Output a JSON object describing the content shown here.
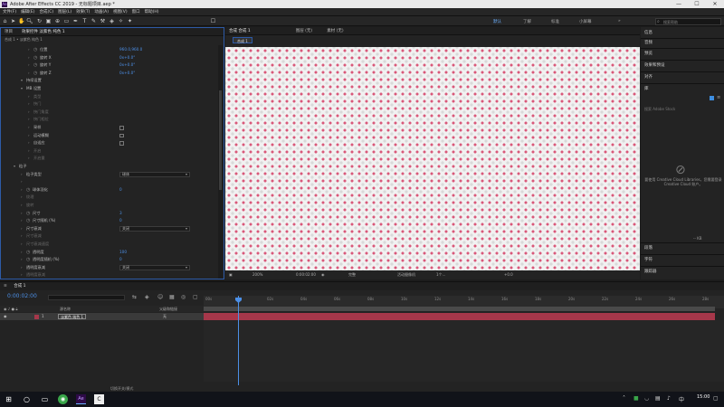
{
  "window": {
    "app_title": "Adobe After Effects CC 2019 - 无标题项目.aep *",
    "minimize": "—",
    "maximize": "☐",
    "close": "✕"
  },
  "menu": [
    "文件(F)",
    "编辑(E)",
    "合成(C)",
    "图层(L)",
    "效果(T)",
    "动画(A)",
    "视图(V)",
    "窗口",
    "帮助(H)"
  ],
  "toolbar": {
    "workspaces": [
      {
        "label": "默认",
        "active": true
      },
      {
        "label": "了解",
        "active": false
      },
      {
        "label": "标准",
        "active": false
      },
      {
        "label": "小屏幕",
        "active": false
      }
    ],
    "workspace_more": "»",
    "search_placeholder": "搜索帮助"
  },
  "left_panel": {
    "tabs": [
      "项目",
      "效果控件 淡紫色 纯色 1"
    ],
    "breadcrumb": "合成 1 • 淡紫色 纯色 1",
    "props": [
      {
        "label": "位置",
        "value": "960.0,960.0",
        "indent": 2,
        "stopwatch": true,
        "kind": "value"
      },
      {
        "label": "旋转 X",
        "value": "0x+0.0°",
        "indent": 2,
        "stopwatch": true,
        "kind": "value"
      },
      {
        "label": "旋转 Y",
        "value": "0x+0.0°",
        "indent": 2,
        "stopwatch": true,
        "kind": "value"
      },
      {
        "label": "旋转 Z",
        "value": "0x+0.0°",
        "indent": 2,
        "stopwatch": true,
        "kind": "value"
      },
      {
        "label": "持续设置",
        "value": "",
        "indent": 1,
        "stopwatch": false,
        "kind": "group"
      },
      {
        "label": "MB 设置",
        "value": "",
        "indent": 1,
        "stopwatch": false,
        "kind": "group"
      },
      {
        "label": "类型",
        "value": "",
        "indent": 2,
        "stopwatch": false,
        "kind": "dim"
      },
      {
        "label": "快门",
        "value": "",
        "indent": 2,
        "stopwatch": false,
        "kind": "dim"
      },
      {
        "label": "快门角度",
        "value": "",
        "indent": 2,
        "stopwatch": false,
        "kind": "dim"
      },
      {
        "label": "快门相位",
        "value": "",
        "indent": 2,
        "stopwatch": false,
        "kind": "dim"
      },
      {
        "label": "采样",
        "value": "",
        "indent": 2,
        "stopwatch": false,
        "kind": "check"
      },
      {
        "label": "运动模糊",
        "value": "",
        "indent": 2,
        "stopwatch": false,
        "kind": "check"
      },
      {
        "label": "自适应",
        "value": "",
        "indent": 2,
        "stopwatch": false,
        "kind": "check"
      },
      {
        "label": "开启",
        "value": "",
        "indent": 2,
        "stopwatch": false,
        "kind": "dim"
      },
      {
        "label": "开启量",
        "value": "",
        "indent": 2,
        "stopwatch": false,
        "kind": "dim"
      },
      {
        "label": "粒子",
        "value": "",
        "indent": 0,
        "stopwatch": false,
        "kind": "group"
      },
      {
        "label": "粒子类型",
        "value": "球体",
        "indent": 1,
        "stopwatch": false,
        "kind": "dropdown"
      },
      {
        "label": "",
        "value": "",
        "indent": 1,
        "stopwatch": false,
        "kind": "dim"
      },
      {
        "label": "球体羽化",
        "value": "0",
        "indent": 1,
        "stopwatch": true,
        "kind": "value"
      },
      {
        "label": "纹理",
        "value": "",
        "indent": 1,
        "stopwatch": false,
        "kind": "dim"
      },
      {
        "label": "旋转",
        "value": "",
        "indent": 1,
        "stopwatch": false,
        "kind": "dim"
      },
      {
        "label": "尺寸",
        "value": "3",
        "indent": 1,
        "stopwatch": true,
        "kind": "value"
      },
      {
        "label": "尺寸随机 (%)",
        "value": "0",
        "indent": 1,
        "stopwatch": true,
        "kind": "value"
      },
      {
        "label": "尺寸衰减",
        "value": "关闭",
        "indent": 1,
        "stopwatch": false,
        "kind": "dropdown"
      },
      {
        "label": "尺寸衰减",
        "value": "",
        "indent": 1,
        "stopwatch": false,
        "kind": "dim"
      },
      {
        "label": "尺寸衰减速度",
        "value": "",
        "indent": 1,
        "stopwatch": false,
        "kind": "dim"
      },
      {
        "label": "透明度",
        "value": "100",
        "indent": 1,
        "stopwatch": true,
        "kind": "value"
      },
      {
        "label": "透明度随机 (%)",
        "value": "0",
        "indent": 1,
        "stopwatch": true,
        "kind": "value"
      },
      {
        "label": "透明度衰减",
        "value": "关闭",
        "indent": 1,
        "stopwatch": false,
        "kind": "dropdown"
      },
      {
        "label": "透明度衰减",
        "value": "",
        "indent": 1,
        "stopwatch": false,
        "kind": "dim"
      }
    ]
  },
  "viewer": {
    "tabs": [
      "合成 合成 1",
      "图层 (无)",
      "素材 (无)"
    ],
    "subtab": "合成 1",
    "zoom": "200%",
    "timecode": "0:00:02:00",
    "quality": "完整",
    "camera": "活动摄像机",
    "views": "1个...",
    "exposure": "+0.0"
  },
  "right_panel": {
    "items": [
      "信息",
      "音频",
      "预览",
      "效果和预设",
      "对齐",
      "库",
      "段落",
      "字符",
      "跟踪器"
    ],
    "library_search": "搜索 Adobe Stock",
    "cc_text": "要使用 Creative Cloud Libraries，您需要登录 Creative Cloud 账户。",
    "kb": "-- KB"
  },
  "timeline": {
    "tab": "合成 1",
    "timecode": "0:00:02:00",
    "col_source": "源名称",
    "col_mode": "父级和链接",
    "layer_num": "1",
    "layer_name": "淡紫色 纯色 1",
    "layer_parent": "无",
    "ruler": [
      "00s",
      "02s",
      "04s",
      "06s",
      "08s",
      "10s",
      "12s",
      "14s",
      "16s",
      "18s",
      "20s",
      "22s",
      "24s",
      "26s",
      "28s",
      "30s"
    ],
    "footer": "切换开关/模式"
  },
  "taskbar": {
    "time": "15:00"
  },
  "colors": {
    "accent": "#4c8fe6",
    "layer_bar": "#a6374a",
    "dot": "#d9587a"
  }
}
